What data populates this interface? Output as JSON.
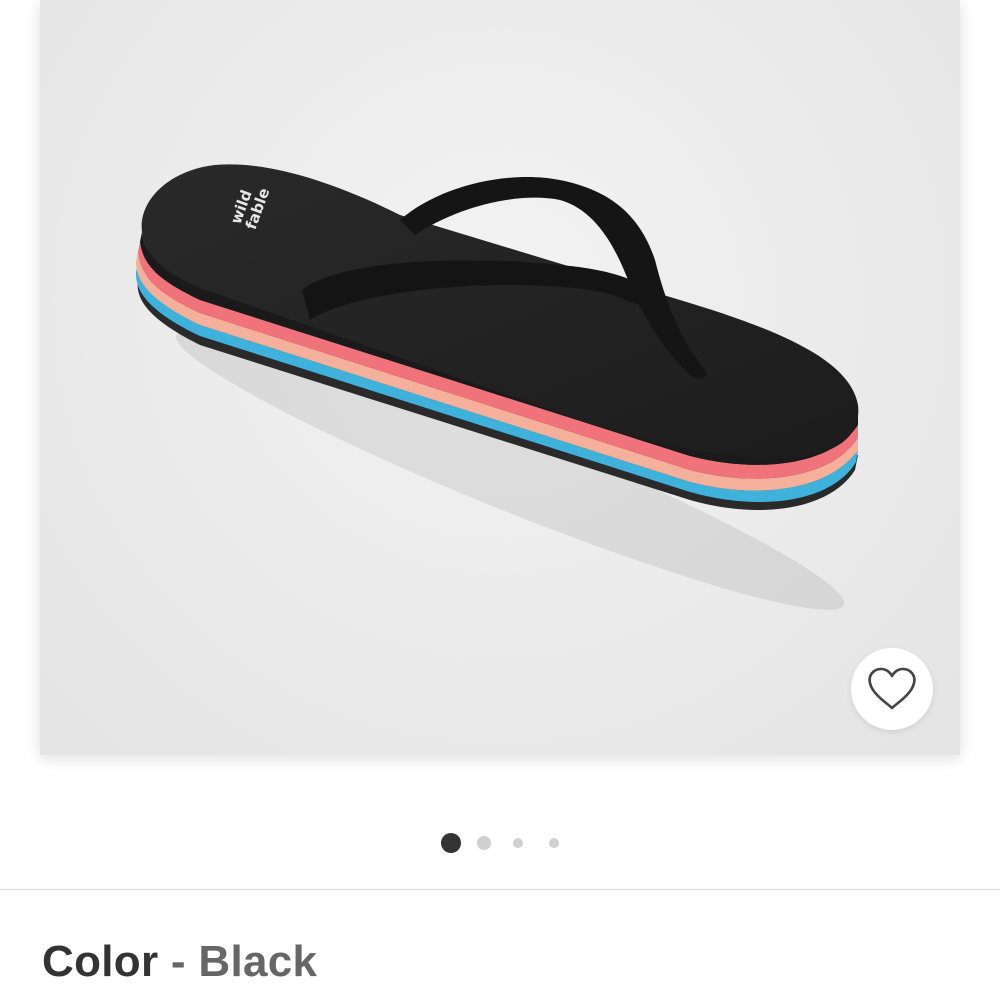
{
  "product": {
    "image_alt": "Black flip flop sandal with pink, peach and blue striped sole",
    "brand_mark_text": "wild fable",
    "favorite_icon": "heart-outline-icon"
  },
  "gallery": {
    "total_images": 4,
    "active_index": 0
  },
  "color_selector": {
    "label": "Color",
    "separator": " - ",
    "value": "Black"
  },
  "colors": {
    "background": "#ededed",
    "sole_black": "#1f1f1f",
    "stripe_pink": "#f0727a",
    "stripe_peach": "#f4b09a",
    "stripe_blue": "#3fb2dc",
    "dot_active": "#333333",
    "dot_inactive": "#cfcfcf"
  }
}
